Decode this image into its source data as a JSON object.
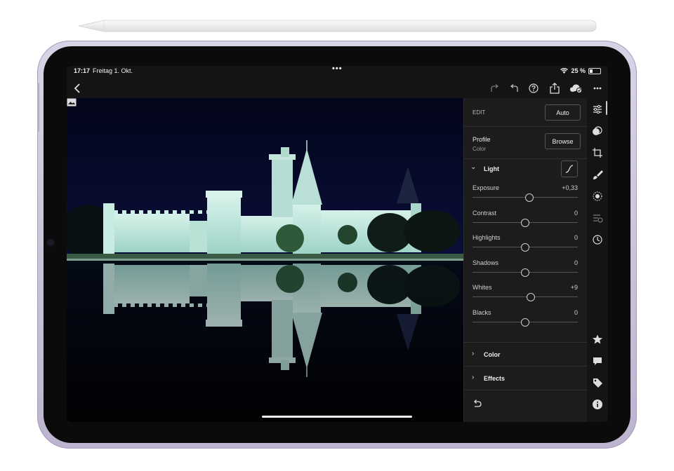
{
  "status_bar": {
    "time": "17:17",
    "date": "Freitag 1. Okt.",
    "dots": "•••",
    "battery": "25 %"
  },
  "toolbar": {
    "back_icon": "chevron-left-icon",
    "icons": [
      "redo-icon",
      "undo-icon",
      "help-icon",
      "share-icon",
      "cloud-sync-icon",
      "more-icon"
    ]
  },
  "edit": {
    "header_label": "EDIT",
    "auto_label": "Auto",
    "profile_label": "Profile",
    "profile_value": "Color",
    "browse_label": "Browse",
    "light_title": "Light",
    "sliders": [
      {
        "name": "Exposure",
        "value": "+0,33",
        "level": 0.54
      },
      {
        "name": "Contrast",
        "value": "0",
        "level": 0.5
      },
      {
        "name": "Highlights",
        "value": "0",
        "level": 0.5
      },
      {
        "name": "Shadows",
        "value": "0",
        "level": 0.5
      },
      {
        "name": "Whites",
        "value": "+9",
        "level": 0.55
      },
      {
        "name": "Blacks",
        "value": "0",
        "level": 0.5
      }
    ],
    "color_title": "Color",
    "effects_title": "Effects"
  },
  "side_icons": [
    "edit-sliders-icon",
    "presets-icon",
    "crop-icon",
    "healing-brush-icon",
    "masking-icon",
    "versions-icon",
    "history-icon",
    "star-icon",
    "comment-icon",
    "tag-icon",
    "info-icon"
  ],
  "colors": {
    "panel_bg": "#1c1c1c",
    "photo_sky": "#05071a",
    "castle_light": "#bfe8dd",
    "device_frame": "#d2cce0"
  }
}
